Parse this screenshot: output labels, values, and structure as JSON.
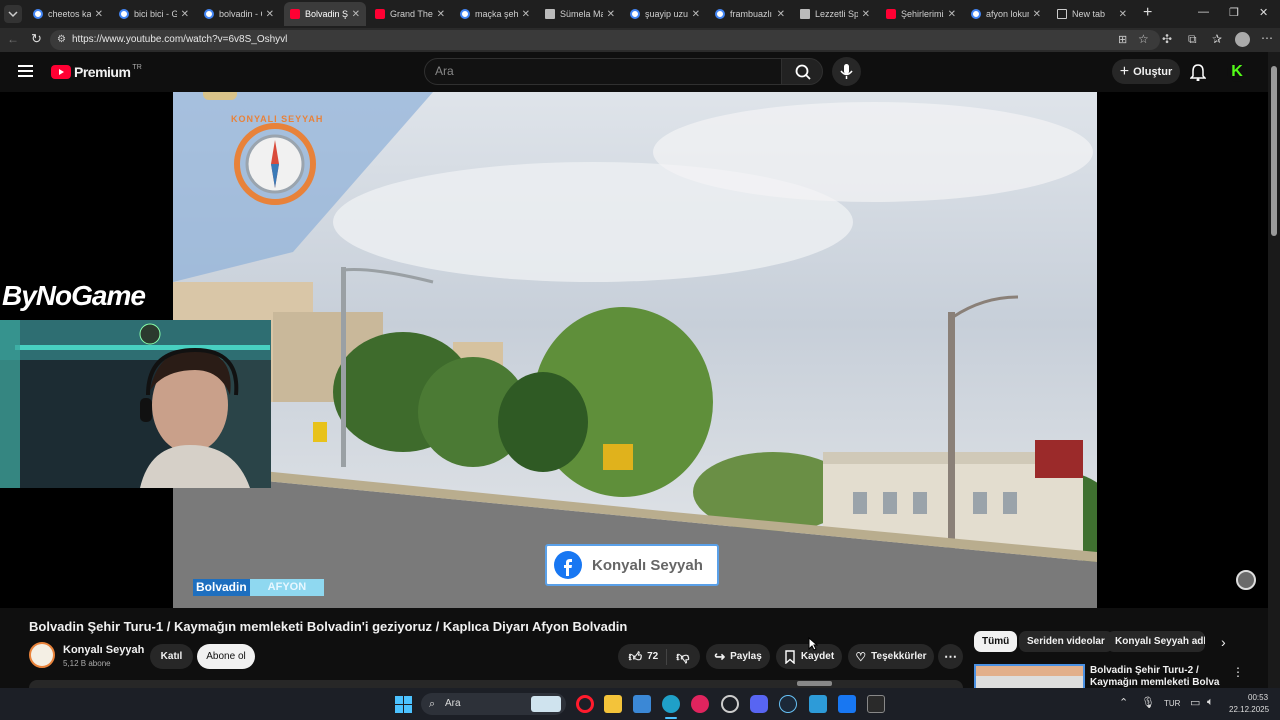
{
  "browser": {
    "tabs": [
      {
        "label": "cheetos karşı",
        "icon": "google-icon",
        "active": false
      },
      {
        "label": "bici bici - Go",
        "icon": "google-icon",
        "active": false
      },
      {
        "label": "bolvadin - Go",
        "icon": "google-icon",
        "active": false
      },
      {
        "label": "Bolvadin Şeh",
        "icon": "youtube-icon",
        "active": true
      },
      {
        "label": "Grand Theft A",
        "icon": "youtube-icon",
        "active": false
      },
      {
        "label": "maçka şehir n",
        "icon": "google-icon",
        "active": false
      },
      {
        "label": "Sümela Mana",
        "icon": "site-icon",
        "active": false
      },
      {
        "label": "şuayip uzun",
        "icon": "google-icon",
        "active": false
      },
      {
        "label": "frambuazlı ki",
        "icon": "google-icon",
        "active": false
      },
      {
        "label": "Lezzetli Spes",
        "icon": "doc-icon",
        "active": false
      },
      {
        "label": "Şehirlerimizde",
        "icon": "youtube-icon",
        "active": false
      },
      {
        "label": "afyon lokum",
        "icon": "google-icon",
        "active": false
      },
      {
        "label": "New tab",
        "icon": "newtab-icon",
        "active": false
      }
    ],
    "url": "https://www.youtube.com/watch?v=6v8S_Oshyvl"
  },
  "youtube": {
    "logo_text": "Premium",
    "region": "TR",
    "search_placeholder": "Ara",
    "create_label": "Oluştur"
  },
  "video": {
    "overlay_brand": "ByNoGame",
    "channel_watermark": "KONYALI SEYYAH",
    "facebook_banner": "Konyalı Seyyah",
    "location_tag": "Bolvadin",
    "location_tag2": "AFYON",
    "title": "Bolvadin Şehir Turu-1 / Kaymağın memleketi Bolvadin'i geziyoruz / Kaplıca Diyarı Afyon Bolvadin"
  },
  "channel": {
    "name": "Konyalı Seyyah",
    "subscribers": "5,12 B abone",
    "join_label": "Katıl",
    "subscribe_label": "Abone ol"
  },
  "actions": {
    "likes": "72",
    "share_label": "Paylaş",
    "save_label": "Kaydet",
    "thanks_label": "Teşekkürler"
  },
  "chips": [
    "Tümü",
    "Seriden videolar",
    "Konyalı Seyyah adlı y"
  ],
  "recommendation": {
    "title_line1": "Bolvadin Şehir Turu-2 /",
    "title_line2": "Kaymağın memleketi Bolvadin'"
  },
  "taskbar": {
    "search_label": "Ara",
    "language": "TUR",
    "time": "00:53",
    "date": "22.12.2025"
  }
}
